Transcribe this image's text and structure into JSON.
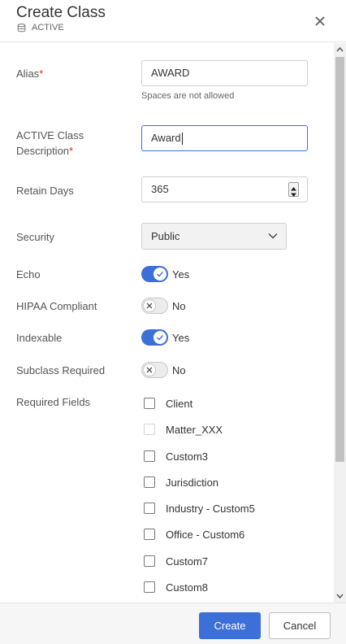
{
  "header": {
    "title": "Create Class",
    "subtitle": "ACTIVE"
  },
  "form": {
    "alias": {
      "label": "Alias",
      "required_mark": "*",
      "value": "AWARD",
      "hint": "Spaces are not allowed"
    },
    "description": {
      "label_line1": "ACTIVE Class",
      "label_line2": "Description",
      "required_mark": "*",
      "value": "Award"
    },
    "retain_days": {
      "label": "Retain Days",
      "value": "365"
    },
    "security": {
      "label": "Security",
      "selected": "Public"
    },
    "echo": {
      "label": "Echo",
      "on": true,
      "text": "Yes"
    },
    "hipaa": {
      "label": "HIPAA Compliant",
      "on": false,
      "text": "No"
    },
    "indexable": {
      "label": "Indexable",
      "on": true,
      "text": "Yes"
    },
    "subclass": {
      "label": "Subclass Required",
      "on": false,
      "text": "No"
    },
    "required_fields": {
      "label": "Required Fields",
      "items": [
        {
          "label": "Client",
          "checked": false,
          "disabled": false
        },
        {
          "label": "Matter_XXX",
          "checked": false,
          "disabled": true
        },
        {
          "label": "Custom3",
          "checked": false,
          "disabled": false
        },
        {
          "label": "Jurisdiction",
          "checked": false,
          "disabled": false
        },
        {
          "label": "Industry - Custom5",
          "checked": false,
          "disabled": false
        },
        {
          "label": "Office - Custom6",
          "checked": false,
          "disabled": false
        },
        {
          "label": "Custom7",
          "checked": false,
          "disabled": false
        },
        {
          "label": "Custom8",
          "checked": false,
          "disabled": false
        }
      ]
    }
  },
  "footer": {
    "create_label": "Create",
    "cancel_label": "Cancel"
  },
  "colors": {
    "accent": "#3d6fd8",
    "required": "#c0392b"
  }
}
